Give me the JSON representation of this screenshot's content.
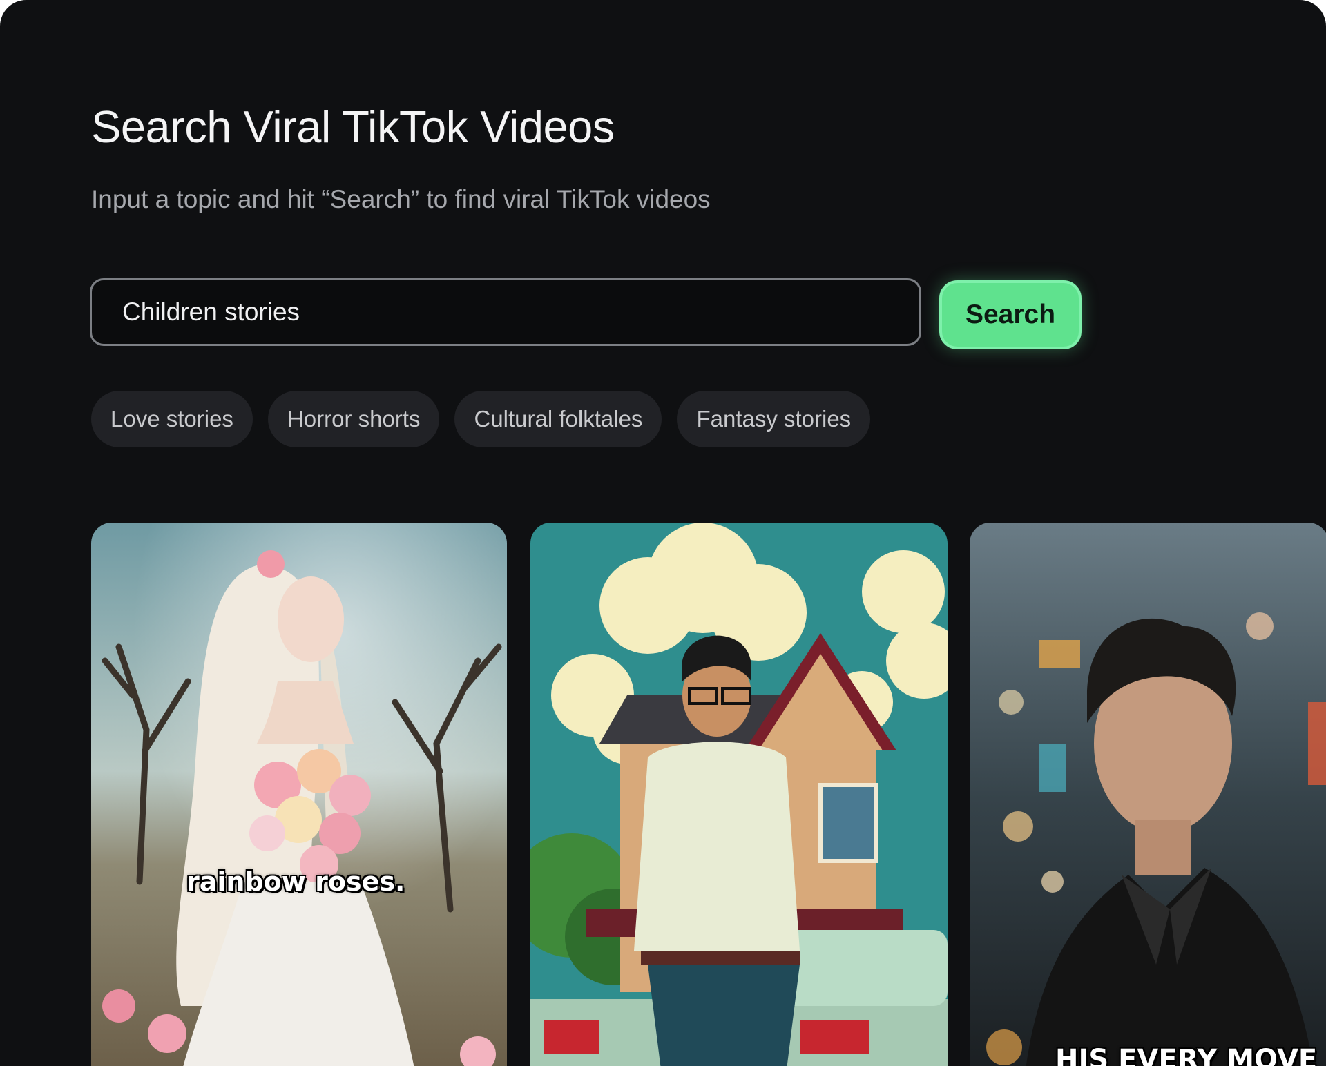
{
  "page": {
    "title": "Search Viral TikTok Videos",
    "subtitle": "Input a topic and hit “Search” to find viral TikTok videos"
  },
  "search": {
    "value": "Children stories",
    "button_label": "Search"
  },
  "suggestions": [
    {
      "label": "Love stories"
    },
    {
      "label": "Horror shorts"
    },
    {
      "label": "Cultural folktales"
    },
    {
      "label": "Fantasy stories"
    }
  ],
  "videos": [
    {
      "caption": "rainbow roses."
    },
    {
      "caption": ""
    },
    {
      "caption": "HIS EVERY MOVE"
    }
  ],
  "colors": {
    "background": "#0f1012",
    "accent": "#5fe28e",
    "chip": "#212226"
  }
}
